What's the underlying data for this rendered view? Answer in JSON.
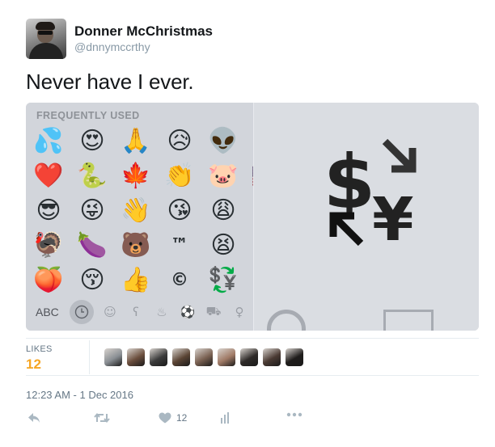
{
  "user": {
    "display_name": "Donner McChristmas",
    "handle": "@dnnymccrthy"
  },
  "tweet": {
    "text": "Never have I ever.",
    "timestamp": "12:23 AM - 1 Dec 2016"
  },
  "keyboard": {
    "section_title": "FREQUENTLY USED",
    "abc_label": "ABC",
    "emojis": [
      "💦",
      "😍",
      "🙏",
      "😥",
      "👽",
      "😛",
      "❤️",
      "🐍",
      "🍁",
      "👏",
      "🐷",
      "🇺🇸",
      "😎",
      "😜",
      "👋",
      "😘",
      "😩",
      "🚬",
      "🦃",
      "🍆",
      "🐻",
      "™",
      "😫",
      "🔪",
      "🍑",
      "😚",
      "👍",
      "©",
      "💱",
      "🍔"
    ],
    "categories": [
      "clock-icon",
      "smiley-icon",
      "bear-icon",
      "food-icon",
      "ball-icon",
      "car-icon",
      "bulb-icon"
    ]
  },
  "stats": {
    "likes_label": "LIKES",
    "likes_count": "12",
    "liker_colors": [
      "#8a8f94",
      "#6b4e3d",
      "#3b3b3b",
      "#5a4434",
      "#7a6152",
      "#a07a66",
      "#2e2a28",
      "#4a3a33",
      "#1f1c1b"
    ]
  },
  "actions": {
    "reply_icon": "reply-icon",
    "retweet_icon": "retweet-icon",
    "like_icon": "heart-icon",
    "like_count": "12",
    "analytics_icon": "analytics-icon",
    "more_icon": "more-icon"
  },
  "colors": {
    "accent_orange": "#f6a623",
    "muted": "#657786",
    "action_grey": "#aab8c2"
  }
}
